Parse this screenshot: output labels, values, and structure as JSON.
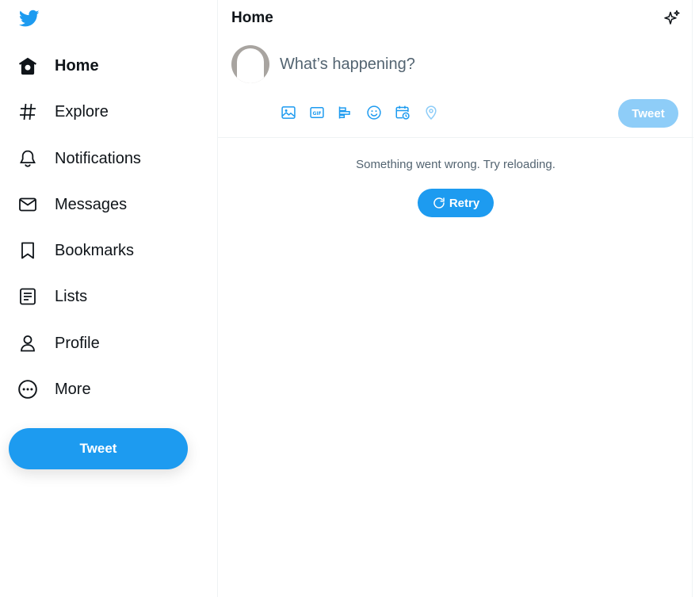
{
  "colors": {
    "brand": "#1d9bf0",
    "brand_disabled": "#8ecdf8",
    "text_primary": "#0f1419",
    "text_secondary": "#536471",
    "border": "#eff3f4"
  },
  "sidebar": {
    "logo_icon": "twitter-bird-icon",
    "items": [
      {
        "label": "Home",
        "icon": "home-icon",
        "active": true
      },
      {
        "label": "Explore",
        "icon": "hashtag-icon",
        "active": false
      },
      {
        "label": "Notifications",
        "icon": "bell-icon",
        "active": false
      },
      {
        "label": "Messages",
        "icon": "envelope-icon",
        "active": false
      },
      {
        "label": "Bookmarks",
        "icon": "bookmark-icon",
        "active": false
      },
      {
        "label": "Lists",
        "icon": "list-icon",
        "active": false
      },
      {
        "label": "Profile",
        "icon": "person-icon",
        "active": false
      },
      {
        "label": "More",
        "icon": "more-circle-icon",
        "active": false
      }
    ],
    "tweet_button": "Tweet"
  },
  "main": {
    "title": "Home",
    "header_icon": "sparkle-icon",
    "composer": {
      "placeholder": "What’s happening?",
      "tools": [
        "image-icon",
        "gif-icon",
        "poll-icon",
        "emoji-icon",
        "schedule-icon",
        "location-icon"
      ],
      "tweet_button": "Tweet"
    },
    "error": {
      "message": "Something went wrong. Try reloading.",
      "retry_label": "Retry",
      "retry_icon": "refresh-icon"
    }
  }
}
